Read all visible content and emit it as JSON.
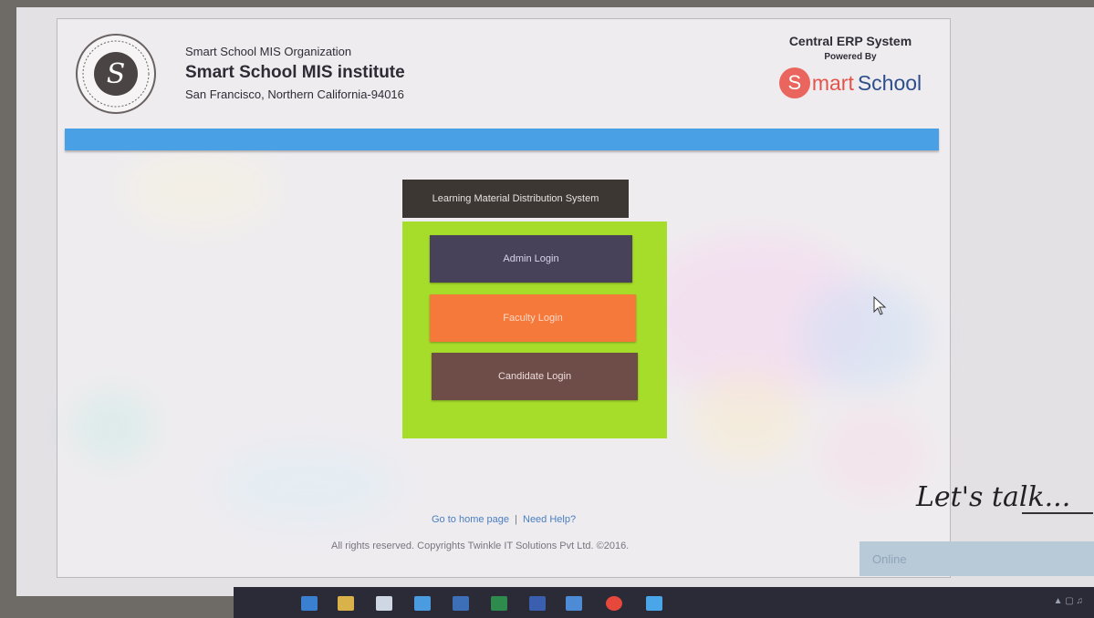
{
  "header": {
    "org_small": "Smart School MIS Organization",
    "org_big": "Smart School MIS institute",
    "address": "San Francisco, Northern California-94016",
    "seal_letter": "S",
    "erp_title": "Central ERP System",
    "powered_by": "Powered By",
    "brand_s": "S",
    "brand_mart": "mart",
    "brand_school": "School"
  },
  "login": {
    "system_title": "Learning Material Distribution System",
    "admin_label": "Admin Login",
    "faculty_label": "Faculty Login",
    "candidate_label": "Candidate Login"
  },
  "footer": {
    "home_link": "Go to home page",
    "separator": "|",
    "help_link": "Need Help?",
    "copyright": "All rights reserved. Copyrights Twinkle IT Solutions Pvt Ltd. ©2016."
  },
  "chat": {
    "lets_talk": "Let's talk...",
    "status": "Online"
  },
  "colors": {
    "blue_bar": "#4aa0e4",
    "panel_green": "#a6dc2a",
    "admin_btn": "#47425a",
    "faculty_btn": "#f6793c",
    "candidate_btn": "#6e4d49",
    "title_bar": "#3d3733"
  }
}
